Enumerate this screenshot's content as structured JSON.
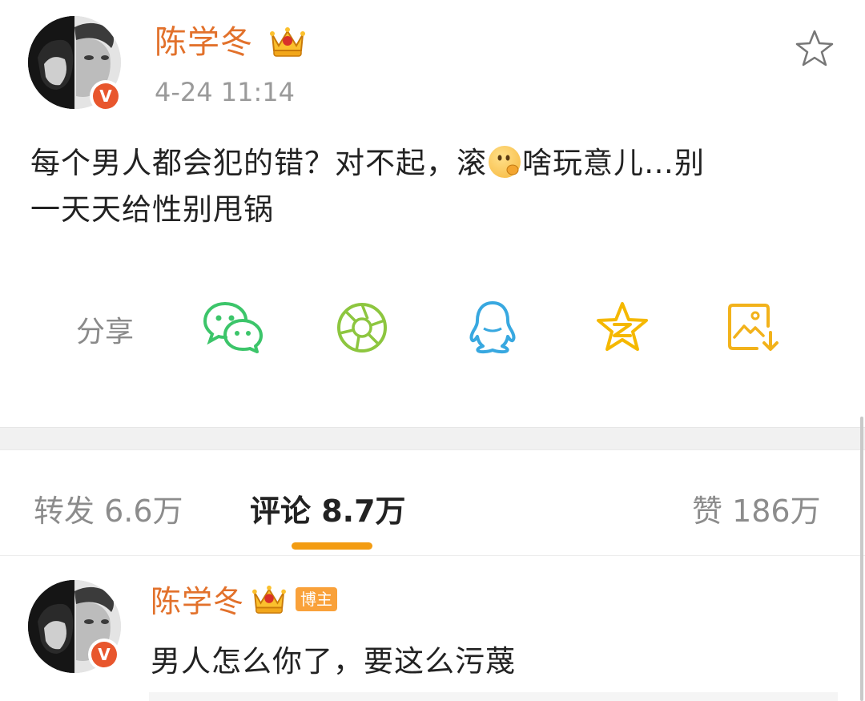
{
  "post": {
    "author": "陈学冬",
    "timestamp": "4-24 11:14",
    "text_part1": "每个男人都会犯的错？对不起，滚",
    "text_part2": "啥玩意儿…别",
    "text_line2": "一天天给性别甩锅",
    "verified_badge": "V"
  },
  "share": {
    "label": "分享",
    "icons": [
      "wechat-icon",
      "moments-icon",
      "qq-icon",
      "qzone-icon",
      "save-image-icon"
    ]
  },
  "tabs": {
    "repost": "转发 6.6万",
    "comments": "评论 8.7万",
    "likes": "赞 186万"
  },
  "comment": {
    "author": "陈学冬",
    "badge": "博主",
    "text": "男人怎么你了，要这么污蔑",
    "verified_badge": "V"
  },
  "colors": {
    "username": "#e2712b",
    "accent_underline": "#f39c12",
    "verified": "#e8562d",
    "wechat": "#3cc56a",
    "moments": "#8dc63f",
    "qq": "#38a8e0",
    "qzone": "#f5b800",
    "save": "#f2b21b"
  }
}
